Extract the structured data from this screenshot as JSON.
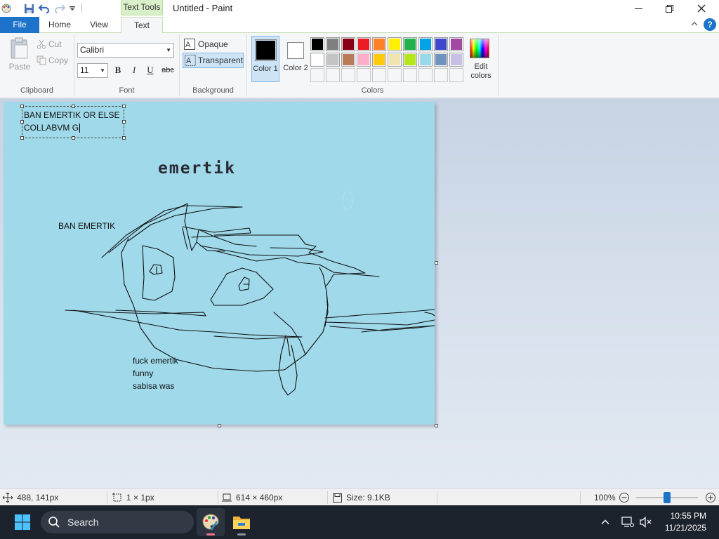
{
  "titlebar": {
    "context_tab": "Text Tools",
    "title": "Untitled - Paint"
  },
  "tabs": {
    "file": "File",
    "home": "Home",
    "view": "View",
    "text": "Text"
  },
  "ribbon": {
    "clipboard": {
      "paste": "Paste",
      "cut": "Cut",
      "copy": "Copy",
      "label": "Clipboard"
    },
    "font": {
      "family": "Calibri",
      "size": "11",
      "bold": "B",
      "italic": "I",
      "underline": "U",
      "strike": "abc",
      "label": "Font"
    },
    "background": {
      "opaque": "Opaque",
      "transparent": "Transparent",
      "label": "Background"
    },
    "colors": {
      "color1": "Color 1",
      "color2": "Color 2",
      "edit": "Edit colors",
      "label": "Colors",
      "color1_value": "#000000",
      "color2_value": "#ffffff",
      "palette_row1": [
        "#000000",
        "#7f7f7f",
        "#880015",
        "#ed1c24",
        "#ff7f27",
        "#fff200",
        "#22b14c",
        "#00a2e8",
        "#3f48cc",
        "#a349a4"
      ],
      "palette_row2": [
        "#ffffff",
        "#c3c3c3",
        "#b97a57",
        "#ffaec9",
        "#ffc90e",
        "#efe4b0",
        "#b5e61d",
        "#99d9ea",
        "#7092be",
        "#c8bfe7"
      ],
      "palette_row3": [
        "#ffffff",
        "#ffffff",
        "#ffffff",
        "#ffffff",
        "#ffffff",
        "#ffffff",
        "#ffffff",
        "#ffffff",
        "#ffffff",
        "#ffffff"
      ]
    }
  },
  "canvas": {
    "background": "#9fd9ea",
    "textbox_line1": "BAN EMERTIK OR ELSE",
    "textbox_line2": "COLLABVM G",
    "heading_text": "emertik",
    "ban_text": "BAN EMERTIK",
    "note_line1": "fuck emertik",
    "note_line2": "funny",
    "note_line3": "sabisa was"
  },
  "statusbar": {
    "cursor_pos": "488, 141px",
    "selection_size": "1 × 1px",
    "canvas_size": "614 × 460px",
    "file_size": "Size: 9.1KB",
    "zoom": "100%",
    "zoom_level": 0.5
  },
  "taskbar": {
    "search_label": "Search",
    "time": "10:55 PM",
    "date": "11/21/2025"
  }
}
